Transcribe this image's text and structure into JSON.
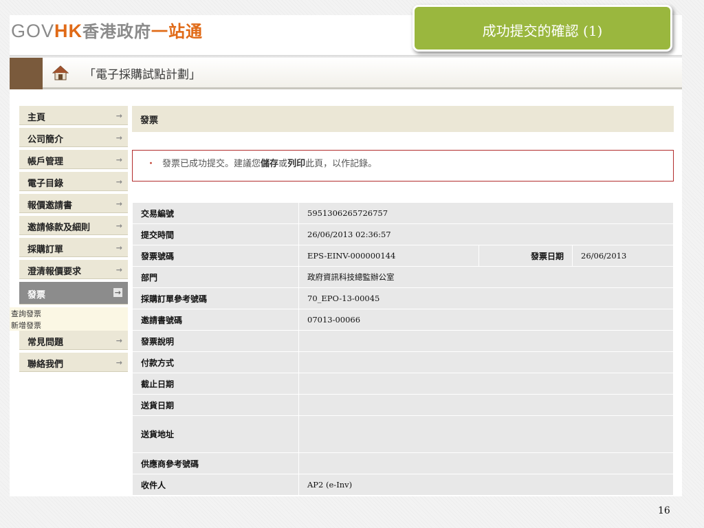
{
  "header": {
    "logo_gov": "GOV",
    "logo_hk": "HK",
    "logo_cn1": "香港政府",
    "logo_cn2": "一站通",
    "banner_title": "「電子採購試點計劃」"
  },
  "slide": {
    "title": "成功提交的確認 (1)",
    "page_number": "16"
  },
  "sidebar": {
    "items": [
      {
        "label": "主頁"
      },
      {
        "label": "公司簡介"
      },
      {
        "label": "帳戶管理"
      },
      {
        "label": "電子目錄"
      },
      {
        "label": "報價邀請書"
      },
      {
        "label": "邀請條款及細則"
      },
      {
        "label": "採購訂單"
      },
      {
        "label": "澄清報價要求"
      },
      {
        "label": "發票"
      },
      {
        "label": "常見問題"
      },
      {
        "label": "聯絡我們"
      }
    ],
    "subitems": [
      {
        "label": "查詢發票"
      },
      {
        "label": "新增發票"
      }
    ]
  },
  "main": {
    "section_title": "發票",
    "message": {
      "bullet": "・",
      "part1": "發票已成功提交。建議您",
      "save": "儲存",
      "or": "或",
      "print": "列印",
      "part2": "此頁，以作記錄。"
    },
    "table": {
      "rows": [
        {
          "label": "交易編號",
          "value": "5951306265726757"
        },
        {
          "label": "提交時間",
          "value": "26/06/2013 02:36:57"
        },
        {
          "label": "發票號碼",
          "value": "EPS-EINV-000000144",
          "label2": "發票日期",
          "value2": "26/06/2013"
        },
        {
          "label": "部門",
          "value": "政府資訊科技總監辦公室"
        },
        {
          "label": "採購訂單參考號碼",
          "value": "70_EPO-13-00045"
        },
        {
          "label": "邀請書號碼",
          "value": "07013-00066"
        },
        {
          "label": "發票說明",
          "value": ""
        },
        {
          "label": "付款方式",
          "value": ""
        },
        {
          "label": "截止日期",
          "value": ""
        },
        {
          "label": "送貨日期",
          "value": ""
        },
        {
          "label": "送貨地址",
          "value": ""
        },
        {
          "label": "供應商參考號碼",
          "value": ""
        },
        {
          "label": "收件人",
          "value": "AP2 (e-Inv)"
        }
      ]
    }
  },
  "colors": {
    "title_box": "#9ab73e",
    "logo_orange": "#e06a17",
    "nav_bg": "#ebe7d6",
    "nav_active": "#8c8c8c",
    "message_border": "#b22b2b"
  }
}
